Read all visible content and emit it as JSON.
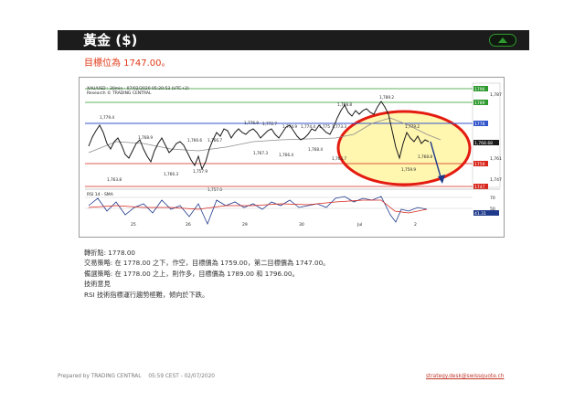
{
  "header": {
    "title": "黃金 ($)",
    "toggle_icon": "chevron-up-icon"
  },
  "target_line": "目標位為 1747.00。",
  "chart": {
    "line1": "XAU/USD : 30min - 07/02/2020 05:20:53 (UTC+2)",
    "line2": "Research © TRADING CENTRAL",
    "indicator_label": "RSI 14 - SMA",
    "price_labels": [
      "1,779.4",
      "1,768.9",
      "1,763.8",
      "1,766.3",
      "1,766.6",
      "1,766.7",
      "1,757.9",
      "1,757.0",
      "1,776.9",
      "1,772.7",
      "1,767.3",
      "1,774.9",
      "1,774.4",
      "1,775",
      "1,773.3",
      "1,768.4",
      "1,766.4",
      "1,763.7",
      "1,788.8",
      "1,789.2",
      "1,779.2",
      "1,768.8",
      "1,759.9"
    ],
    "right_levels": [
      "1796",
      "1,787",
      "1789",
      "1778",
      "1,768.68",
      "1,761",
      "1759",
      "1,747",
      "1747"
    ],
    "rsi_scale": [
      "70",
      "50",
      "41.31"
    ],
    "x_labels": [
      "25",
      "26",
      "29",
      "30",
      "Jul",
      "2"
    ],
    "colors": {
      "candle": "#1a1a1a",
      "resistance": "#2e9a2e",
      "pivot": "#3355cc",
      "support": "#d9261c",
      "ellipse": "#e41b10",
      "ellipse_fill": "#fff6b0",
      "arrow": "#1f3a8a",
      "rsi": "#1f3a8a",
      "rsi_sma": "#d9261c"
    }
  },
  "notes": {
    "pivot": "轉折點: 1778.00",
    "strategy": "交易策略: 在 1778.00 之下，作空，目標價為 1759.00，第二目標價為 1747.00。",
    "alternative": "備選策略: 在 1778.00 之上，則作多，目標價為 1789.00 和 1796.00。",
    "tech_title": "技術意見",
    "tech_body": "RSI 技術指標運行趨勢極難，傾向於下跌。"
  },
  "footer": {
    "prepared_by": "Prepared by TRADING CENTRAL",
    "time": "05:59 CEST - 02/07/2020",
    "email": "strategy.desk@swissquote.ch"
  }
}
